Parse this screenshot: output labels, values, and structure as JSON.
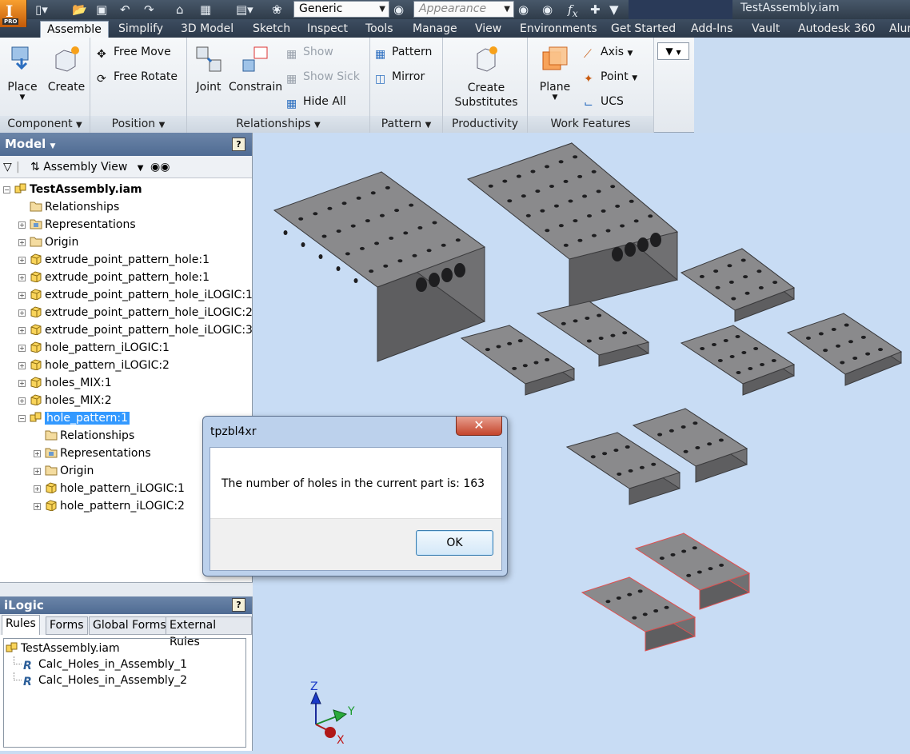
{
  "app": {
    "badge": "PRO",
    "document_title": "TestAssembly.iam",
    "material_value": "Generic",
    "appearance_placeholder": "Appearance"
  },
  "tabs": [
    "Assemble",
    "Simplify",
    "3D Model",
    "Sketch",
    "Inspect",
    "Tools",
    "Manage",
    "View",
    "Environments",
    "Get Started",
    "Add-Ins",
    "Vault",
    "Autodesk 360",
    "Alur"
  ],
  "active_tab": "Assemble",
  "ribbon": {
    "component": {
      "label": "Component",
      "place": "Place",
      "create": "Create"
    },
    "position": {
      "label": "Position",
      "free_move": "Free Move",
      "free_rotate": "Free Rotate"
    },
    "relationships": {
      "label": "Relationships",
      "joint": "Joint",
      "constrain": "Constrain",
      "show": "Show",
      "show_sick": "Show Sick",
      "hide_all": "Hide All"
    },
    "pattern": {
      "label": "Pattern",
      "pattern": "Pattern",
      "mirror": "Mirror"
    },
    "productivity": {
      "label": "Productivity",
      "create_substitutes_1": "Create",
      "create_substitutes_2": "Substitutes"
    },
    "work_features": {
      "label": "Work Features",
      "plane": "Plane",
      "axis": "Axis",
      "point": "Point",
      "ucs": "UCS"
    }
  },
  "model_panel": {
    "title": "Model",
    "view_label": "Assembly View",
    "tree": [
      {
        "label": "TestAssembly.iam",
        "level": 0,
        "icon": "assembly",
        "expander": "minus",
        "bold": true
      },
      {
        "label": "Relationships",
        "level": 1,
        "icon": "folder",
        "expander": "none"
      },
      {
        "label": "Representations",
        "level": 1,
        "icon": "representations",
        "expander": "plus"
      },
      {
        "label": "Origin",
        "level": 1,
        "icon": "folder",
        "expander": "plus"
      },
      {
        "label": "extrude_point_pattern_hole:1",
        "level": 1,
        "icon": "part",
        "expander": "plus"
      },
      {
        "label": "extrude_point_pattern_hole:1",
        "level": 1,
        "icon": "part",
        "expander": "plus"
      },
      {
        "label": "extrude_point_pattern_hole_iLOGIC:1",
        "level": 1,
        "icon": "part",
        "expander": "plus"
      },
      {
        "label": "extrude_point_pattern_hole_iLOGIC:2",
        "level": 1,
        "icon": "part",
        "expander": "plus"
      },
      {
        "label": "extrude_point_pattern_hole_iLOGIC:3",
        "level": 1,
        "icon": "part",
        "expander": "plus"
      },
      {
        "label": "hole_pattern_iLOGIC:1",
        "level": 1,
        "icon": "part",
        "expander": "plus"
      },
      {
        "label": "hole_pattern_iLOGIC:2",
        "level": 1,
        "icon": "part",
        "expander": "plus"
      },
      {
        "label": "holes_MIX:1",
        "level": 1,
        "icon": "part",
        "expander": "plus"
      },
      {
        "label": "holes_MIX:2",
        "level": 1,
        "icon": "part",
        "expander": "plus"
      },
      {
        "label": "hole_pattern:1",
        "level": 1,
        "icon": "assembly",
        "expander": "minus",
        "selected": true
      },
      {
        "label": "Relationships",
        "level": 2,
        "icon": "folder",
        "expander": "none"
      },
      {
        "label": "Representations",
        "level": 2,
        "icon": "representations",
        "expander": "plus"
      },
      {
        "label": "Origin",
        "level": 2,
        "icon": "folder",
        "expander": "plus"
      },
      {
        "label": "hole_pattern_iLOGIC:1",
        "level": 2,
        "icon": "part",
        "expander": "plus"
      },
      {
        "label": "hole_pattern_iLOGIC:2",
        "level": 2,
        "icon": "part",
        "expander": "plus"
      }
    ]
  },
  "ilogic_panel": {
    "title": "iLogic",
    "tabs": [
      "Rules",
      "Forms",
      "Global Forms",
      "External Rules"
    ],
    "active_tab": "Rules",
    "root": "TestAssembly.iam",
    "rules": [
      "Calc_Holes_in_Assembly_1",
      "Calc_Holes_in_Assembly_2"
    ]
  },
  "dialog": {
    "title": "tpzbl4xr",
    "message": "The number of holes in the current part is:  163",
    "ok": "OK"
  },
  "triad": {
    "z": "Z",
    "y": "Y",
    "x": "X"
  },
  "colors": {
    "viewport_bg": "#c8dcf4",
    "part_top": "#8a8a8c",
    "part_side": "#5e5e60",
    "selection_edge": "#e05050",
    "tree_selection": "#3399ff"
  }
}
